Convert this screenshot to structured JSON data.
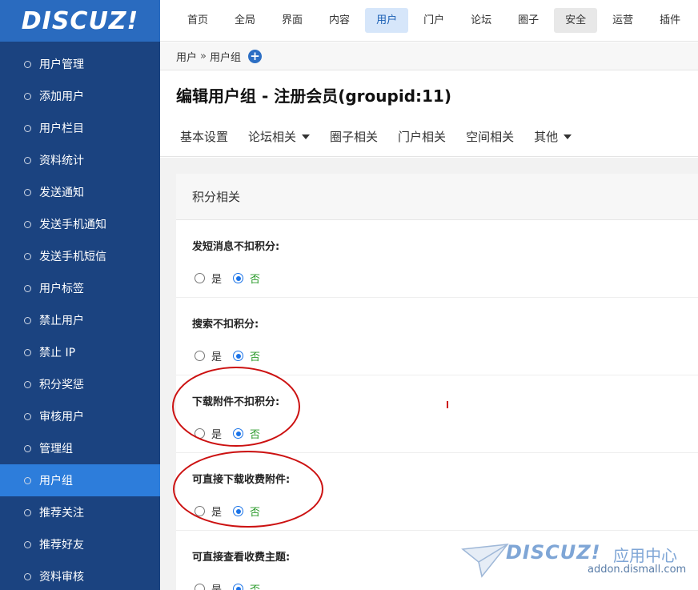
{
  "brand": {
    "logo_text": "DISCUZ!"
  },
  "sidebar": {
    "items": [
      {
        "label": "用户管理",
        "active": false
      },
      {
        "label": "添加用户",
        "active": false
      },
      {
        "label": "用户栏目",
        "active": false
      },
      {
        "label": "资料统计",
        "active": false
      },
      {
        "label": "发送通知",
        "active": false
      },
      {
        "label": "发送手机通知",
        "active": false
      },
      {
        "label": "发送手机短信",
        "active": false
      },
      {
        "label": "用户标签",
        "active": false
      },
      {
        "label": "禁止用户",
        "active": false
      },
      {
        "label": "禁止 IP",
        "active": false
      },
      {
        "label": "积分奖惩",
        "active": false
      },
      {
        "label": "审核用户",
        "active": false
      },
      {
        "label": "管理组",
        "active": false
      },
      {
        "label": "用户组",
        "active": true
      },
      {
        "label": "推荐关注",
        "active": false
      },
      {
        "label": "推荐好友",
        "active": false
      },
      {
        "label": "资料审核",
        "active": false
      }
    ]
  },
  "topnav": {
    "tabs": [
      {
        "label": "首页",
        "state": ""
      },
      {
        "label": "全局",
        "state": ""
      },
      {
        "label": "界面",
        "state": ""
      },
      {
        "label": "内容",
        "state": ""
      },
      {
        "label": "用户",
        "state": "active"
      },
      {
        "label": "门户",
        "state": ""
      },
      {
        "label": "论坛",
        "state": ""
      },
      {
        "label": "圈子",
        "state": ""
      },
      {
        "label": "安全",
        "state": "hover"
      },
      {
        "label": "运营",
        "state": ""
      },
      {
        "label": "插件",
        "state": ""
      }
    ]
  },
  "breadcrumb": {
    "parent": "用户",
    "separator": "»",
    "current": "用户组",
    "add_icon": "plus-circle-icon"
  },
  "page": {
    "title": "编辑用户组 - 注册会员(groupid:11)"
  },
  "subtabs": [
    {
      "label": "基本设置",
      "dropdown": false
    },
    {
      "label": "论坛相关",
      "dropdown": true
    },
    {
      "label": "圈子相关",
      "dropdown": false
    },
    {
      "label": "门户相关",
      "dropdown": false
    },
    {
      "label": "空间相关",
      "dropdown": false
    },
    {
      "label": "其他",
      "dropdown": true
    }
  ],
  "section": {
    "title": "积分相关",
    "settings": [
      {
        "label": "发短消息不扣积分:",
        "yes": "是",
        "no": "否",
        "value": "no"
      },
      {
        "label": "搜索不扣积分:",
        "yes": "是",
        "no": "否",
        "value": "no"
      },
      {
        "label": "下载附件不扣积分:",
        "yes": "是",
        "no": "否",
        "value": "no"
      },
      {
        "label": "可直接下载收费附件:",
        "yes": "是",
        "no": "否",
        "value": "no"
      },
      {
        "label": "可直接查看收费主题:",
        "yes": "是",
        "no": "否",
        "value": "no"
      }
    ]
  },
  "watermark": {
    "logo_text": "DISCUZ!",
    "center_text": "应用中心",
    "url": "addon.dismall.com"
  },
  "colors": {
    "sidebar_bg": "#1b4380",
    "sidebar_active": "#2d7ddb",
    "logo_bg": "#2a6bbf",
    "accent_blue": "#1a73e8",
    "no_option_green": "#2a9a2a",
    "annotation_red": "#cc1111"
  }
}
